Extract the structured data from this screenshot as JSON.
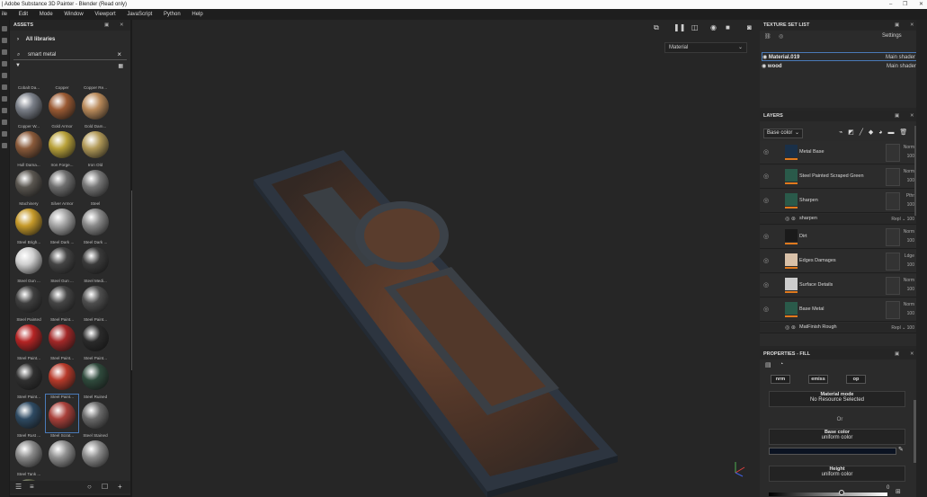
{
  "window": {
    "title": "| Adobe Substance 3D Painter - Blender (Read only)"
  },
  "menu": [
    "ile",
    "Edit",
    "Mode",
    "Window",
    "Viewport",
    "JavaScript",
    "Python",
    "Help"
  ],
  "assets": {
    "title": "ASSETS",
    "libraries": "All libraries",
    "search_value": "smart metal",
    "items": [
      {
        "label": "Cobalt Da...",
        "color": "#7a7f88"
      },
      {
        "label": "Copper",
        "color": "#9a5a33"
      },
      {
        "label": "Copper Re...",
        "color": "#b98a5a"
      },
      {
        "label": "Copper W...",
        "color": "#8a5a3a"
      },
      {
        "label": "Gold Armor",
        "color": "#b9a23a"
      },
      {
        "label": "Gold Dam...",
        "color": "#b29a58"
      },
      {
        "label": "Hull Dama...",
        "color": "#5a5650"
      },
      {
        "label": "Iron Forge...",
        "color": "#6f6f6f"
      },
      {
        "label": "Iron Old",
        "color": "#777777"
      },
      {
        "label": "Machinery",
        "color": "#c69a2a"
      },
      {
        "label": "Silver Armor",
        "color": "#a5a5a5"
      },
      {
        "label": "Steel",
        "color": "#8a8a8a"
      },
      {
        "label": "Steel Brigh...",
        "color": "#cfcfcf"
      },
      {
        "label": "Steel Dark ...",
        "color": "#444444"
      },
      {
        "label": "Steel Dark ...",
        "color": "#3a3a3a"
      },
      {
        "label": "Steel Gun ...",
        "color": "#3f3f3f"
      },
      {
        "label": "Steel Gun ...",
        "color": "#454545"
      },
      {
        "label": "Steel Medi...",
        "color": "#4e4e4e"
      },
      {
        "label": "Steel Painted",
        "color": "#b52424"
      },
      {
        "label": "Steel Paint...",
        "color": "#a32828"
      },
      {
        "label": "Steel Paint...",
        "color": "#2a2a2a"
      },
      {
        "label": "Steel Paint...",
        "color": "#303030"
      },
      {
        "label": "Steel Paint...",
        "color": "#b83a2a"
      },
      {
        "label": "Steel Paint...",
        "color": "#2f4a3c"
      },
      {
        "label": "Steel Paint...",
        "color": "#2e4a62"
      },
      {
        "label": "Steel Paint...",
        "color": "#a9403a"
      },
      {
        "label": "Steel Ruined",
        "color": "#6a6a6a"
      },
      {
        "label": "Steel Rust ...",
        "color": "#8a8a8a"
      },
      {
        "label": "Steel Scrat...",
        "color": "#909090"
      },
      {
        "label": "Steel Stained",
        "color": "#8c8c8c"
      },
      {
        "label": "Steel Tank ...",
        "color": "#5a5f48"
      }
    ]
  },
  "viewport": {
    "material_mode": "Material"
  },
  "texture_set_list": {
    "title": "TEXTURE SET LIST",
    "settings": "Settings",
    "sets": [
      {
        "name": "Material.019",
        "shader": "Main shader"
      },
      {
        "name": "wood",
        "shader": "Main shader"
      }
    ]
  },
  "layers": {
    "title": "LAYERS",
    "channel": "Base color",
    "rows": [
      {
        "name": "Metal Base",
        "blend": "Norm",
        "opacity": "100",
        "thumb": "#1a3048",
        "sub": false
      },
      {
        "name": "Steel Painted Scraped Green",
        "blend": "Norm",
        "opacity": "100",
        "thumb": "#2a5a4a",
        "sub": false
      },
      {
        "name": "Sharpen",
        "blend": "Pthr",
        "opacity": "100",
        "thumb": "#2a5a4a",
        "sub": false
      },
      {
        "name": "sharpen",
        "blend": "Repl",
        "opacity": "100",
        "thumb": "",
        "sub": true
      },
      {
        "name": "Dirt",
        "blend": "Norm",
        "opacity": "100",
        "thumb": "#1a1a1a",
        "sub": false
      },
      {
        "name": "Edges Damages",
        "blend": "Ldge",
        "opacity": "100",
        "thumb": "#d8c0a8",
        "sub": false
      },
      {
        "name": "Surface Details",
        "blend": "Norm",
        "opacity": "100",
        "thumb": "#cccccc",
        "sub": false
      },
      {
        "name": "Base Metal",
        "blend": "Norm",
        "opacity": "100",
        "thumb": "#2a5a4a",
        "sub": false
      },
      {
        "name": "MatFinish Rough",
        "blend": "Repl",
        "opacity": "100",
        "thumb": "",
        "sub": true
      }
    ]
  },
  "properties": {
    "title": "PROPERTIES - FILL",
    "chips": [
      "nrm",
      "emiss",
      "op"
    ],
    "material_mode_label": "Material mode",
    "material_mode_value": "No Resource Selected",
    "or": "Or",
    "base_color_label": "Base color",
    "base_color_value": "uniform color",
    "height_label": "Height",
    "height_value": "uniform color",
    "height_number": "0"
  }
}
